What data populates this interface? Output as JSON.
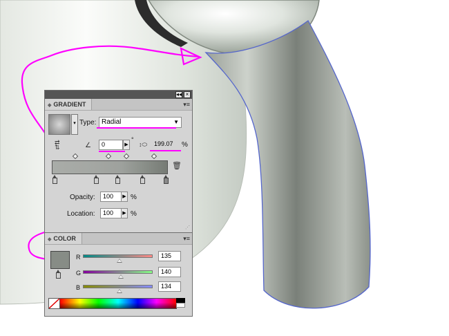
{
  "gradient_panel": {
    "tab_label": "GRADIENT",
    "type_label": "Type:",
    "type_value": "Radial",
    "angle_value": "0",
    "angle_degree_symbol": "°",
    "aspect_value": "199.07",
    "percent_symbol": "%",
    "opacity_label": "Opacity:",
    "opacity_value": "100",
    "location_label": "Location:",
    "location_value": "100"
  },
  "color_panel": {
    "tab_label": "COLOR",
    "channels": [
      {
        "label": "R",
        "value": "135"
      },
      {
        "label": "G",
        "value": "140"
      },
      {
        "label": "B",
        "value": "134"
      }
    ],
    "swatch_color": "#878c86"
  },
  "titlebar": {
    "collapse_glyph": "◂◂",
    "close_glyph": "×"
  },
  "colors": {
    "annotation": "#ff00ff",
    "panel_bg": "#d4d4d4",
    "titlebar": "#555555",
    "selection_path": "#5566cc"
  }
}
